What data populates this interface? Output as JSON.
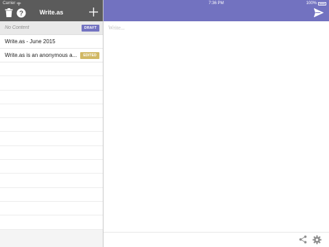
{
  "status": {
    "carrier": "Carrier",
    "time": "7:36 PM",
    "battery": "100%"
  },
  "sidebar": {
    "title": "Write.as",
    "items": [
      {
        "label": "No Content",
        "badge": "DRAFT"
      },
      {
        "label": "Write.as - June 2015"
      },
      {
        "label": "Write.as is an anonymous a...",
        "badge": "EDITED"
      }
    ]
  },
  "editor": {
    "placeholder": "Write..."
  },
  "colors": {
    "accent": "#7272c0",
    "toolbar": "#5b5b5b",
    "edited": "#d1b865",
    "draft": "#7373c1"
  },
  "icons": [
    "trash-icon",
    "help-icon",
    "plus-icon",
    "send-icon",
    "share-icon",
    "gear-icon",
    "wifi-icon",
    "battery-icon"
  ]
}
